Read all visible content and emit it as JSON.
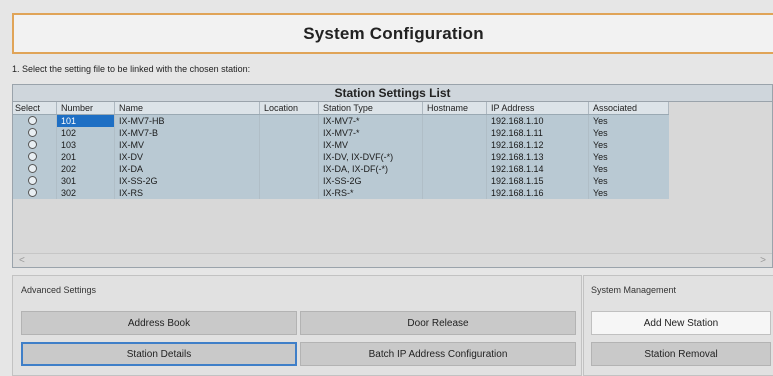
{
  "title": "System Configuration",
  "instruction": "1. Select the setting file to be linked with the chosen station:",
  "station_list": {
    "title": "Station Settings List",
    "columns": [
      "Select",
      "Number",
      "Name",
      "Location",
      "Station Type",
      "Hostname",
      "IP Address",
      "Associated"
    ],
    "rows": [
      {
        "number": "101",
        "name": "IX-MV7-HB",
        "location": "",
        "type": "IX-MV7-*",
        "hostname": "",
        "ip": "192.168.1.10",
        "associated": "Yes"
      },
      {
        "number": "102",
        "name": "IX-MV7-B",
        "location": "",
        "type": "IX-MV7-*",
        "hostname": "",
        "ip": "192.168.1.11",
        "associated": "Yes"
      },
      {
        "number": "103",
        "name": "IX-MV",
        "location": "",
        "type": "IX-MV",
        "hostname": "",
        "ip": "192.168.1.12",
        "associated": "Yes"
      },
      {
        "number": "201",
        "name": "IX-DV",
        "location": "",
        "type": "IX-DV, IX-DVF(-*)",
        "hostname": "",
        "ip": "192.168.1.13",
        "associated": "Yes"
      },
      {
        "number": "202",
        "name": "IX-DA",
        "location": "",
        "type": "IX-DA, IX-DF(-*)",
        "hostname": "",
        "ip": "192.168.1.14",
        "associated": "Yes"
      },
      {
        "number": "301",
        "name": "IX-SS-2G",
        "location": "",
        "type": "IX-SS-2G",
        "hostname": "",
        "ip": "192.168.1.15",
        "associated": "Yes"
      },
      {
        "number": "302",
        "name": "IX-RS",
        "location": "",
        "type": "IX-RS-*",
        "hostname": "",
        "ip": "192.168.1.16",
        "associated": "Yes"
      }
    ],
    "scroll_left": "<",
    "scroll_right": ">"
  },
  "advanced": {
    "label": "Advanced Settings",
    "address_book": "Address Book",
    "door_release": "Door Release",
    "station_details": "Station Details",
    "batch_ip": "Batch IP Address Configuration"
  },
  "system_management": {
    "label": "System Management",
    "add_new_station": "Add New Station",
    "station_removal": "Station Removal"
  },
  "colors": {
    "title_border": "#e0a458",
    "table_bg": "#b9c9d3",
    "selected_number": "#1e6fc4",
    "focus_border": "#3f7fc8"
  }
}
